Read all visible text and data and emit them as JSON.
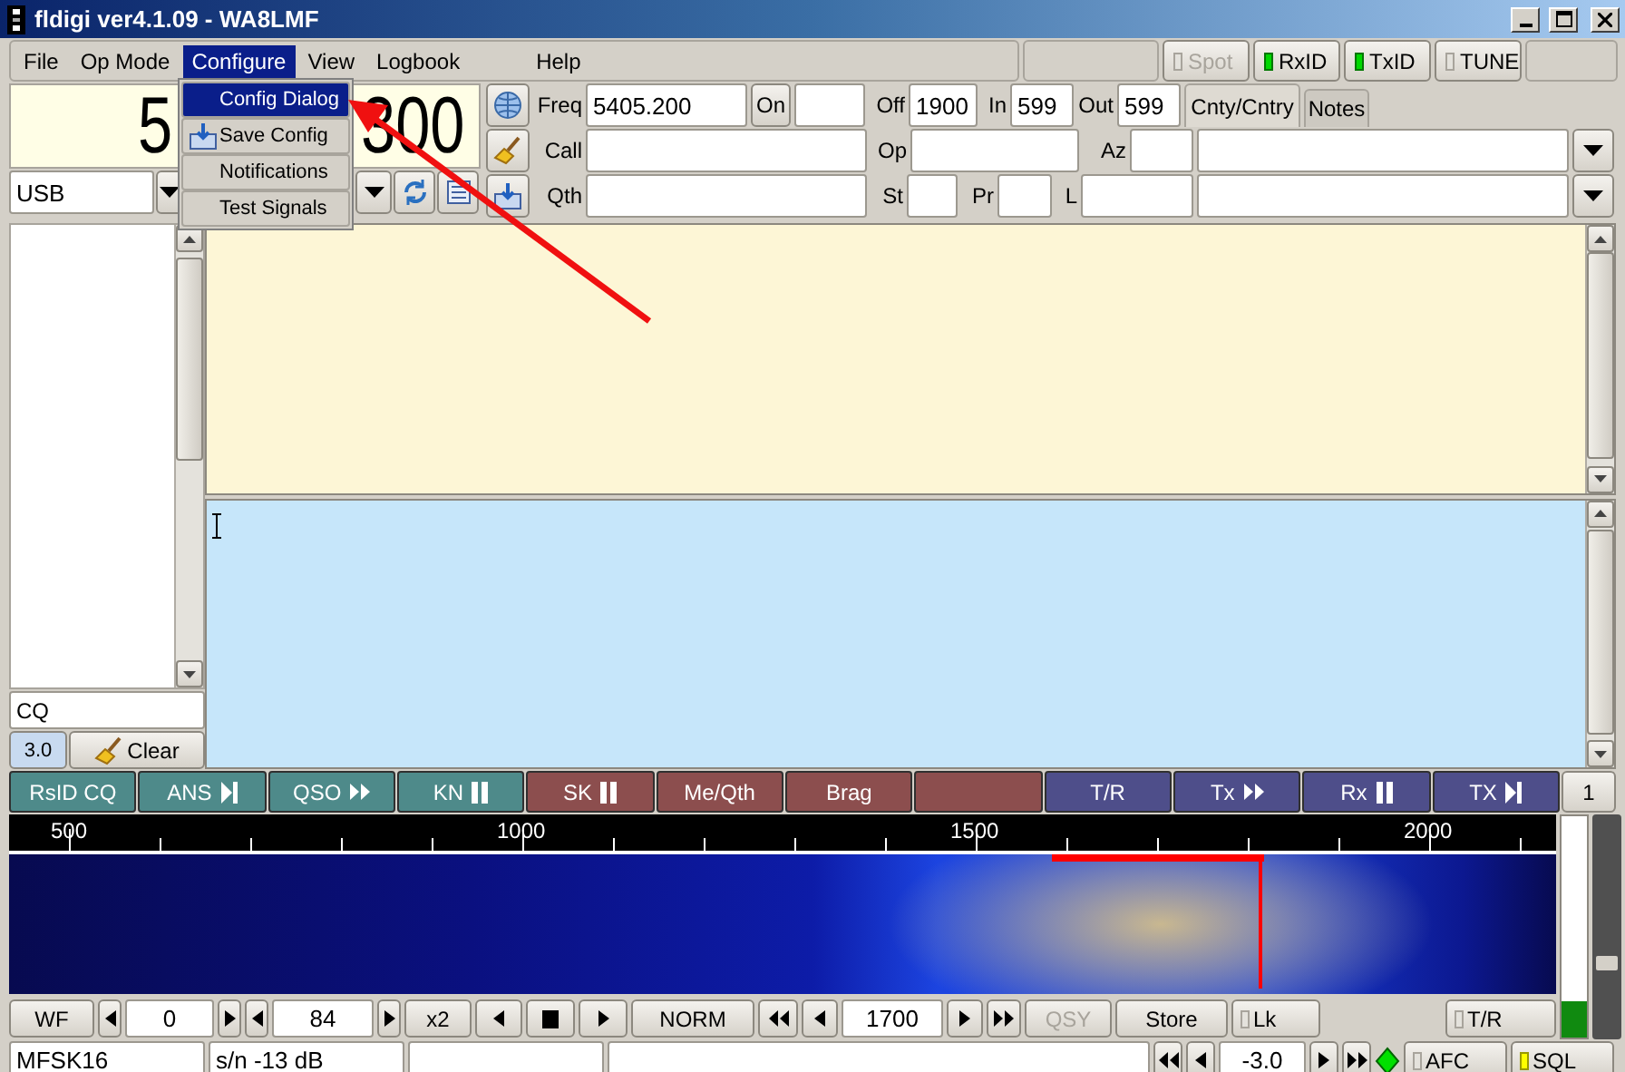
{
  "window": {
    "title": "fldigi ver4.1.09 - WA8LMF"
  },
  "menu": [
    {
      "label": "File",
      "selected": false
    },
    {
      "label": "Op Mode",
      "selected": false
    },
    {
      "label": "Configure",
      "selected": true
    },
    {
      "label": "View",
      "selected": false
    },
    {
      "label": "Logbook",
      "selected": false
    },
    {
      "label": "Help",
      "selected": false
    }
  ],
  "indicators": [
    {
      "label": "Spot",
      "on": false,
      "disabled": true
    },
    {
      "label": "RxID",
      "on": true,
      "disabled": false
    },
    {
      "label": "TxID",
      "on": true,
      "disabled": false
    },
    {
      "label": "TUNE",
      "on": false,
      "disabled": false
    }
  ],
  "open_menu": [
    {
      "label": "Config Dialog",
      "selected": true,
      "icon": false
    },
    {
      "label": "Save Config",
      "selected": false,
      "icon": true
    },
    {
      "label": "Notifications",
      "selected": false,
      "icon": false
    },
    {
      "label": "Test Signals",
      "selected": false,
      "icon": false
    }
  ],
  "frequency_display": {
    "parts": [
      "5",
      "300"
    ]
  },
  "mode_select": {
    "value": "USB"
  },
  "log": {
    "freq_label": "Freq",
    "freq": "5405.200",
    "on_button": "On",
    "off_label": "Off",
    "off": "1900",
    "in_label": "In",
    "in": "599",
    "out_label": "Out",
    "out": "599",
    "call_label": "Call",
    "op_label": "Op",
    "az_label": "Az",
    "qth_label": "Qth",
    "st_label": "St",
    "pr_label": "Pr",
    "l_label": "L",
    "tabs": [
      {
        "label": "Cnty/Cntry",
        "selected": true
      },
      {
        "label": "Notes",
        "selected": false
      }
    ]
  },
  "left_panel": {
    "cq": "CQ",
    "level_button": "3.0",
    "clear_button": "Clear"
  },
  "macros": [
    {
      "label": "RsID CQ",
      "color": "#4e8a8a",
      "kind": "plain"
    },
    {
      "label": "ANS",
      "color": "#4e8a8a",
      "kind": "play-end"
    },
    {
      "label": "QSO",
      "color": "#4e8a8a",
      "kind": "forward"
    },
    {
      "label": "KN",
      "color": "#4e8a8a",
      "kind": "pause"
    },
    {
      "label": "SK",
      "color": "#8c4e4e",
      "kind": "pause"
    },
    {
      "label": "Me/Qth",
      "color": "#8c4e4e",
      "kind": "plain"
    },
    {
      "label": "Brag",
      "color": "#8c4e4e",
      "kind": "plain"
    },
    {
      "color": "#8c4e4e",
      "kind": "plain"
    },
    {
      "label": "T/R",
      "color": "#4e4e8a",
      "kind": "plain"
    },
    {
      "label": "Tx",
      "color": "#4e4e8a",
      "kind": "forward"
    },
    {
      "label": "Rx",
      "color": "#4e4e8a",
      "kind": "pause"
    },
    {
      "label": "TX",
      "color": "#4e4e8a",
      "kind": "play-end"
    }
  ],
  "macro_bank": "1",
  "waterfall": {
    "scale_labels": [
      "500",
      "1000",
      "1500",
      "2000"
    ]
  },
  "signal_meter": {
    "level": 0.16
  },
  "wf_slider": {
    "level": 0.3
  },
  "controls": {
    "wf_button": "WF",
    "low": "0",
    "range": "84",
    "zoom": "x2",
    "speed": "NORM",
    "carrier": "1700",
    "qsy": {
      "label": "QSY",
      "disabled": true
    },
    "store": "Store",
    "lock": {
      "label": "Lk",
      "checked": false
    },
    "tr": {
      "label": "T/R",
      "checked": false
    }
  },
  "status": {
    "mode": "MFSK16",
    "snr": "s/n -13 dB",
    "squelch_value": "-3.0",
    "afc": {
      "label": "AFC",
      "on": false
    },
    "sql": {
      "label": "SQL",
      "on": true
    }
  }
}
